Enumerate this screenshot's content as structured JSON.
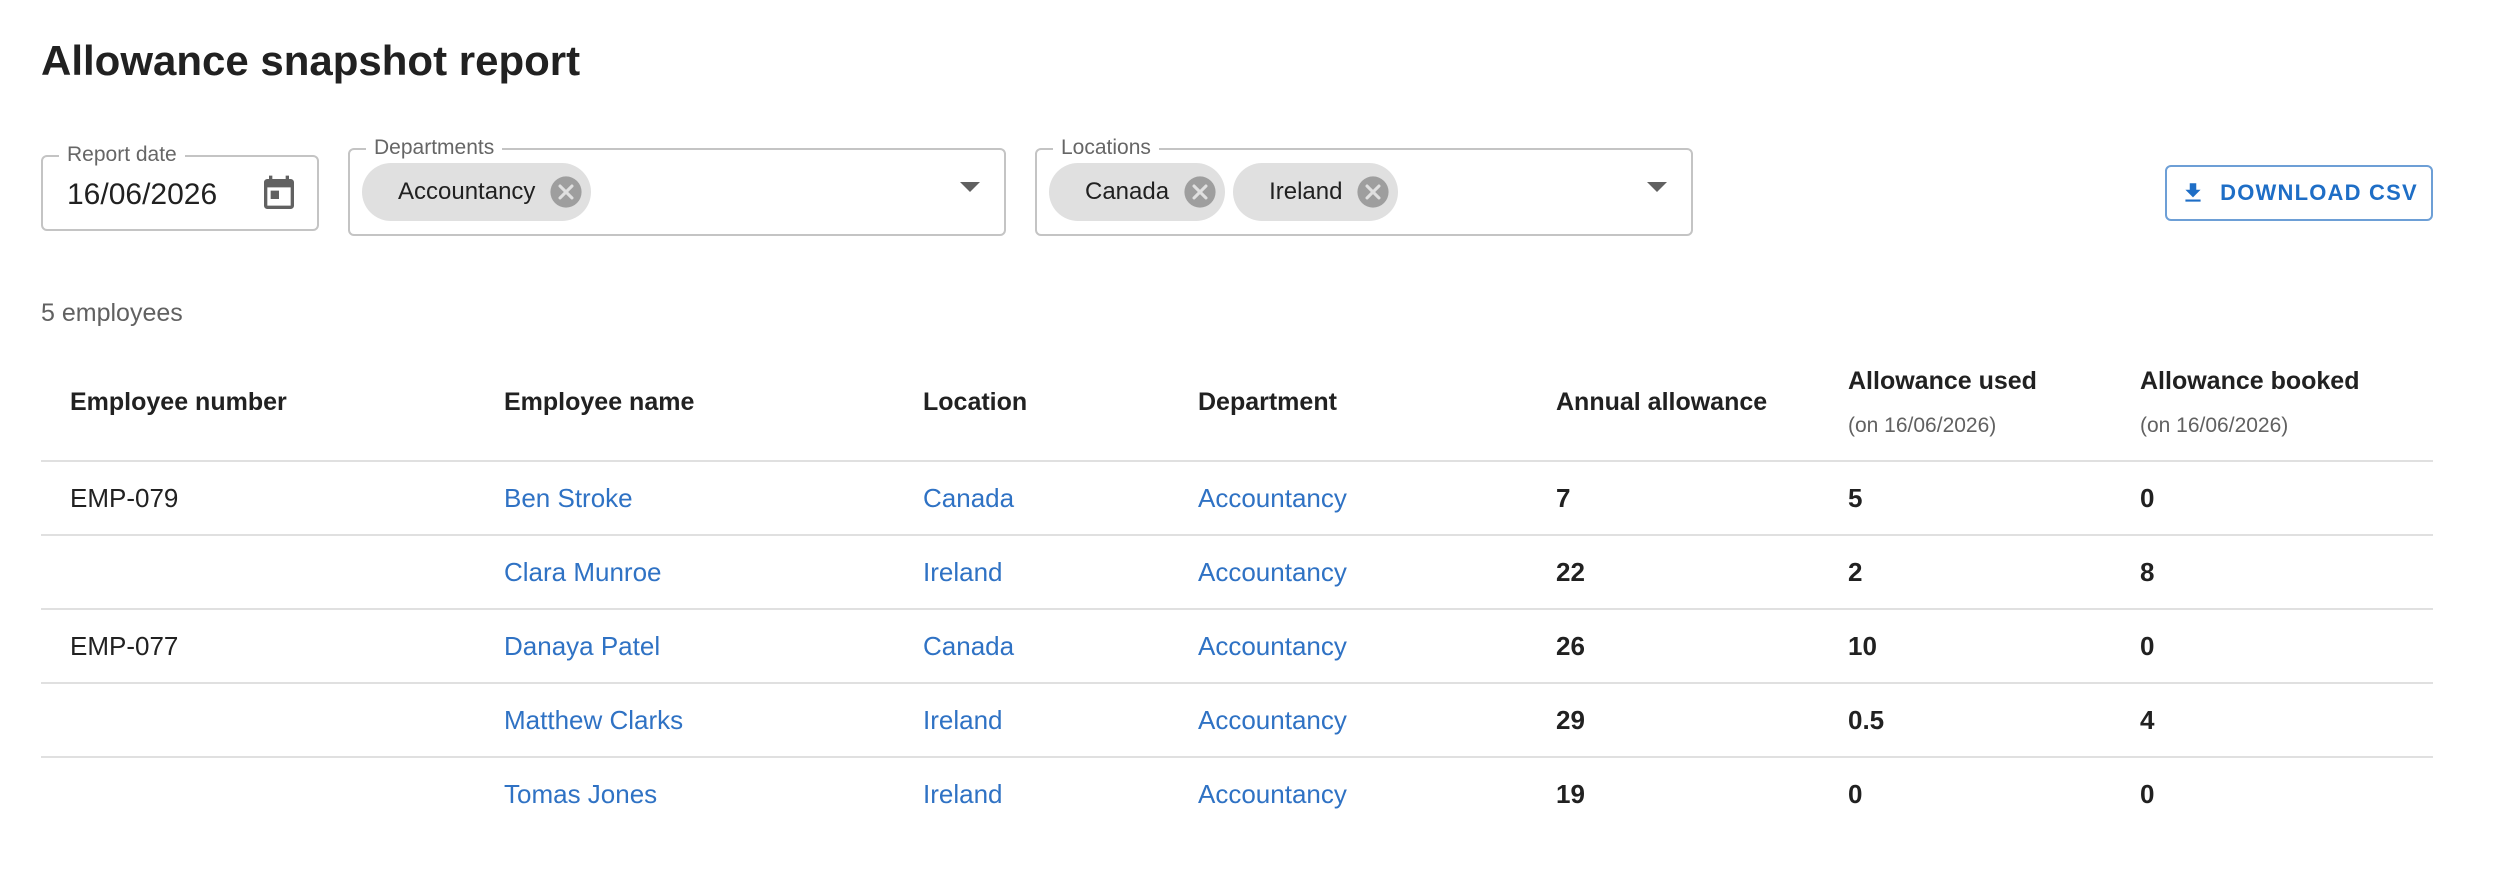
{
  "page": {
    "title": "Allowance snapshot report"
  },
  "filters": {
    "report_date": {
      "label": "Report date",
      "value": "16/06/2026",
      "icon": "calendar-icon"
    },
    "departments": {
      "label": "Departments",
      "chips": [
        "Accountancy"
      ]
    },
    "locations": {
      "label": "Locations",
      "chips": [
        "Canada",
        "Ireland"
      ]
    }
  },
  "toolbar": {
    "download_label": "DOWNLOAD CSV",
    "download_icon": "download-icon"
  },
  "summary": {
    "count_text": "5 employees"
  },
  "table": {
    "headers": {
      "employee_number": "Employee number",
      "employee_name": "Employee name",
      "location": "Location",
      "department": "Department",
      "annual_allowance": "Annual allowance",
      "allowance_used": "Allowance used",
      "allowance_used_sub": "(on 16/06/2026)",
      "allowance_booked": "Allowance booked",
      "allowance_booked_sub": "(on 16/06/2026)"
    },
    "rows": [
      {
        "number": "EMP-079",
        "name": "Ben Stroke",
        "location": "Canada",
        "department": "Accountancy",
        "annual": "7",
        "used": "5",
        "booked": "0"
      },
      {
        "number": "",
        "name": "Clara Munroe",
        "location": "Ireland",
        "department": "Accountancy",
        "annual": "22",
        "used": "2",
        "booked": "8"
      },
      {
        "number": "EMP-077",
        "name": "Danaya Patel",
        "location": "Canada",
        "department": "Accountancy",
        "annual": "26",
        "used": "10",
        "booked": "0"
      },
      {
        "number": "",
        "name": "Matthew Clarks",
        "location": "Ireland",
        "department": "Accountancy",
        "annual": "29",
        "used": "0.5",
        "booked": "4"
      },
      {
        "number": "",
        "name": "Tomas Jones",
        "location": "Ireland",
        "department": "Accountancy",
        "annual": "19",
        "used": "0",
        "booked": "0"
      }
    ]
  },
  "colors": {
    "link": "#2f72c4",
    "accent": "#1e6ec6",
    "chip_background": "#e0e0e0",
    "border": "#c4c4c4"
  }
}
